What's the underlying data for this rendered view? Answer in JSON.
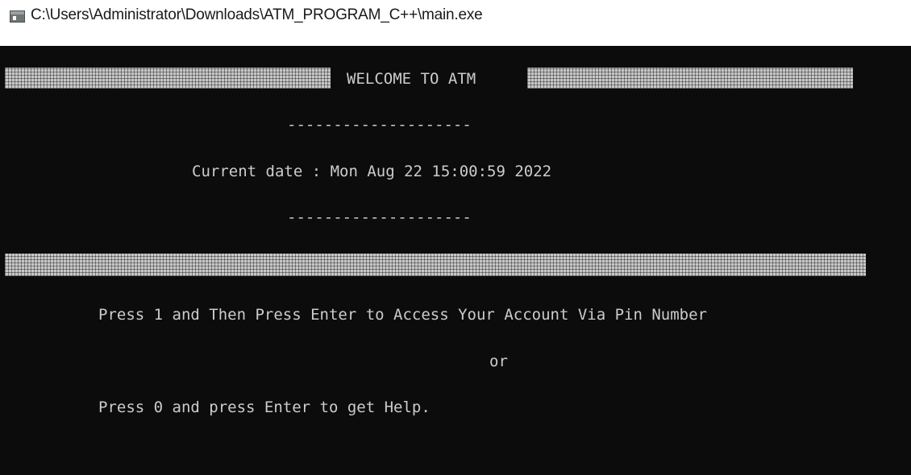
{
  "window": {
    "title": "C:\\Users\\Administrator\\Downloads\\ATM_PROGRAM_C++\\main.exe"
  },
  "console": {
    "welcome": "WELCOME TO ATM",
    "divider_top": "--------------------",
    "date_line": "Current date : Mon Aug 22 15:00:59 2022",
    "divider_bottom": "--------------------",
    "option_1": "Press 1 and Then Press Enter to Access Your Account Via Pin Number",
    "or_text": "or",
    "option_0": "Press 0 and press Enter to get Help."
  },
  "colors": {
    "console_background": "#0c0c0c",
    "console_text": "#cccccc"
  }
}
